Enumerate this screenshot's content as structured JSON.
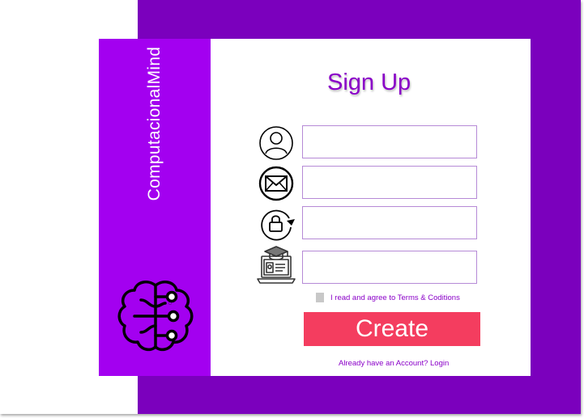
{
  "brand": {
    "name": "ComputacionalMind"
  },
  "form": {
    "title": "Sign Up",
    "fields": [
      {
        "icon": "user-icon",
        "value": ""
      },
      {
        "icon": "mail-icon",
        "value": ""
      },
      {
        "icon": "lock-refresh-icon",
        "value": ""
      },
      {
        "icon": "graduation-laptop-icon",
        "value": ""
      }
    ],
    "terms_label": "I read and agree to Terms & Coditions",
    "terms_checked": false,
    "submit_label": "Create",
    "login_link": "Already have an Account? Login"
  },
  "colors": {
    "background_purple": "#7b00bd",
    "sidebar_purple": "#a300f0",
    "accent_text": "#8a00c8",
    "button_red": "#f43d5f"
  }
}
